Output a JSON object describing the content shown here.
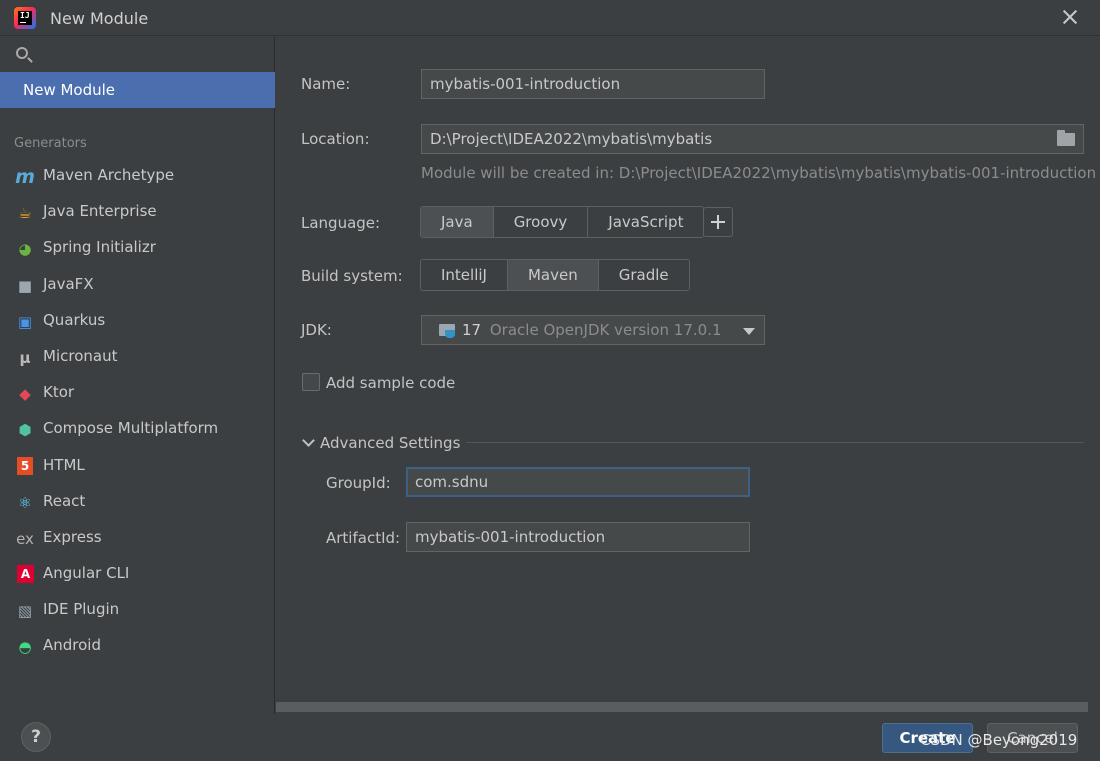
{
  "window": {
    "title": "New Module",
    "app_icon": "intellij-idea-icon"
  },
  "sidebar": {
    "search_placeholder": "",
    "selected_item": "New Module",
    "generators_header": "Generators",
    "generators": [
      {
        "label": "Maven Archetype",
        "icon": "maven-icon",
        "color": "#5aa9d6"
      },
      {
        "label": "Java Enterprise",
        "icon": "java-enterprise-icon",
        "color": "#f5a623"
      },
      {
        "label": "Spring Initializr",
        "icon": "spring-icon",
        "color": "#6db33f"
      },
      {
        "label": "JavaFX",
        "icon": "javafx-folder-icon",
        "color": "#9aa7b0"
      },
      {
        "label": "Quarkus",
        "icon": "quarkus-icon",
        "color": "#4695eb"
      },
      {
        "label": "Micronaut",
        "icon": "micronaut-icon",
        "color": "#b8b8b8"
      },
      {
        "label": "Ktor",
        "icon": "ktor-icon",
        "color": "#e44857"
      },
      {
        "label": "Compose Multiplatform",
        "icon": "compose-icon",
        "color": "#4fc3a1"
      },
      {
        "label": "HTML",
        "icon": "html5-icon",
        "color": "#e44d26"
      },
      {
        "label": "React",
        "icon": "react-icon",
        "color": "#61dafb"
      },
      {
        "label": "Express",
        "icon": "express-icon",
        "color": "#b0b0b0"
      },
      {
        "label": "Angular CLI",
        "icon": "angular-icon",
        "color": "#dd0031"
      },
      {
        "label": "IDE Plugin",
        "icon": "ide-plugin-icon",
        "color": "#9aa7b0"
      },
      {
        "label": "Android",
        "icon": "android-icon",
        "color": "#3ddc84"
      }
    ],
    "help_label": "?"
  },
  "form": {
    "name_label": "Name:",
    "name_value": "mybatis-001-introduction",
    "location_label": "Location:",
    "location_value": "D:\\Project\\IDEA2022\\mybatis\\mybatis",
    "location_hint": "Module will be created in: D:\\Project\\IDEA2022\\mybatis\\mybatis\\mybatis-001-introduction",
    "language_label": "Language:",
    "languages": [
      "Java",
      "Groovy",
      "JavaScript"
    ],
    "language_selected": "Java",
    "build_label": "Build system:",
    "build_systems": [
      "IntelliJ",
      "Maven",
      "Gradle"
    ],
    "build_selected": "Maven",
    "jdk_label": "JDK:",
    "jdk_version": "17",
    "jdk_name": "Oracle OpenJDK version 17.0.1",
    "sample_code_label": "Add sample code",
    "sample_code_checked": false,
    "advanced_label": "Advanced Settings",
    "groupid_label": "GroupId:",
    "groupid_value": "com.sdnu",
    "artifactid_label": "ArtifactId:",
    "artifactid_value": "mybatis-001-introduction"
  },
  "footer": {
    "create_label": "Create",
    "cancel_label": "Cancel",
    "watermark": "CSDN @Beyong2019"
  }
}
